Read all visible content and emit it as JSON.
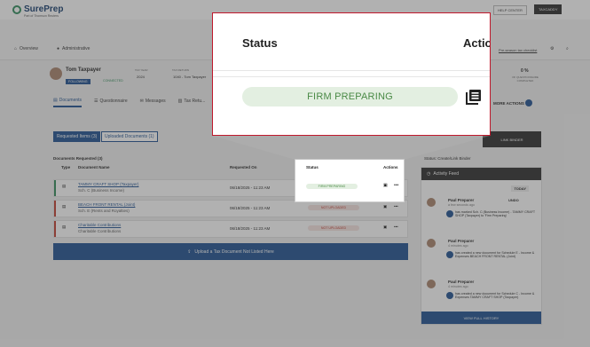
{
  "header": {
    "brand": "SurePrep",
    "brand_sub": "Part of Thomson Reuters",
    "help": "HELP CENTER",
    "account": "TAXCADDY",
    "checklist": "Pre-season tax checklist"
  },
  "nav": {
    "overview": "Overview",
    "admin": "Administrative"
  },
  "client": {
    "name": "Tom Taxpayer",
    "following": "FOLLOWING",
    "connected": "CONNECTED",
    "tax_year_label": "TAX YEAR",
    "tax_year": "2024",
    "tax_return_label": "TAX RETURN",
    "tax_return": "1040 - Tom Taxpayer",
    "stat_value": "0 %",
    "stat_label": "OF QUESTIONNAIRE COMPLETED"
  },
  "tabs": [
    "Documents",
    "Questionnaire",
    "Messages",
    "Tax Retu..."
  ],
  "more_actions": "MORE ACTIONS",
  "subtabs": {
    "requested": "Requested Items (3)",
    "uploaded": "Uploaded Documents (1)"
  },
  "table": {
    "heading": "Documents Requested (3)",
    "headers": {
      "type": "Type",
      "name": "Document Name",
      "requested": "Requested On",
      "status": "Status",
      "actions": "Actions"
    },
    "rows": [
      {
        "name": "TAMMY CRAFT SHOP (Taxpayer)",
        "sub": "Sch. C (Business Income)",
        "date": "06/18/2025 - 11:23 AM",
        "status": "FIRM PREPARING",
        "color": "#2e8b57"
      },
      {
        "name": "BEACH FRONT RENTAL (Joint)",
        "sub": "Sch. E (Rents and Royalties)",
        "date": "06/18/2025 - 11:23 AM",
        "status": "NOT UPLOADED",
        "color": "#c0392b"
      },
      {
        "name": "Charitable Contributions",
        "sub": "Charitable Contributions",
        "date": "06/18/2025 - 11:23 AM",
        "status": "NOT UPLOADED",
        "color": "#c0392b"
      }
    ]
  },
  "upload_label": "Upload a Tax Document Not Listed Here",
  "link_binder": "LINK BINDER",
  "status_text": "Status: Create/Link Binder",
  "feed": {
    "title": "Activity Feed",
    "today": "TODAY",
    "undo": "UNDO",
    "items": [
      {
        "name": "Paul Preparer",
        "time": "a few seconds ago",
        "text": "has marked Sch. C (Business Income) - TAMMY CRAFT SHOP (Taxpayer) to 'Firm Preparing'"
      },
      {
        "name": "Paul Preparer",
        "time": "4 minutes ago",
        "text": "has created a new document for Schedule E - Income & Expenses BEACH FRONT RENTAL (Joint)"
      },
      {
        "name": "Paul Preparer",
        "time": "4 minutes ago",
        "text": "has created a new document for Schedule C - Income & Expenses TAMMY CRAFT SHOP (Taxpayer)"
      }
    ],
    "footer": "VIEW FULL HISTORY"
  },
  "zoom": {
    "status_header": "Status",
    "actions_header": "Actio",
    "status_value": "FIRM PREPARING"
  },
  "colors": {
    "brand": "#1d4f8f",
    "highlight_border": "#c0182b",
    "firm_preparing_bg": "#e3efe1",
    "firm_preparing_text": "#4a8a46"
  }
}
